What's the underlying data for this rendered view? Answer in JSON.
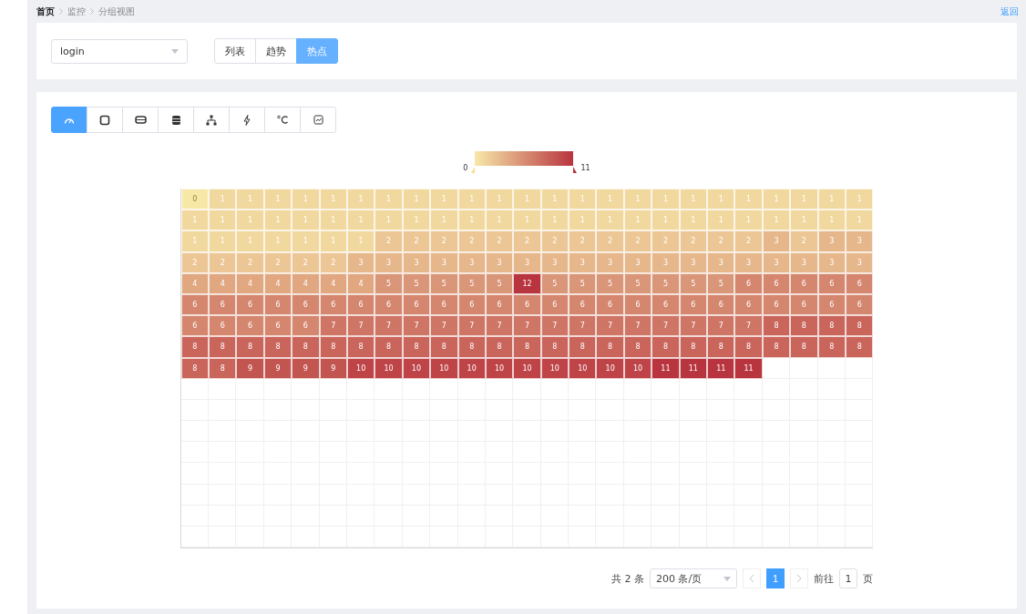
{
  "breadcrumb": [
    {
      "label": "首页",
      "current": true
    },
    {
      "label": "监控",
      "current": false
    },
    {
      "label": "分组视图",
      "current": false
    }
  ],
  "back_link": "返回",
  "group_select": {
    "value": "login"
  },
  "view_tabs": [
    {
      "label": "列表",
      "selected": false
    },
    {
      "label": "趋势",
      "selected": false
    },
    {
      "label": "热点",
      "selected": true
    }
  ],
  "metric_buttons": [
    {
      "kind": "gauge",
      "selected": true
    },
    {
      "kind": "chip",
      "selected": false
    },
    {
      "kind": "memory",
      "selected": false
    },
    {
      "kind": "disk",
      "selected": false
    },
    {
      "kind": "network",
      "selected": false
    },
    {
      "kind": "power",
      "selected": false
    },
    {
      "kind": "temperature",
      "selected": false
    },
    {
      "kind": "file",
      "selected": false
    }
  ],
  "legend": {
    "min": "0",
    "max": "11"
  },
  "heatmap": {
    "rows": [
      [
        "0",
        "1",
        "1",
        "1",
        "1",
        "1",
        "1",
        "1",
        "1",
        "1",
        "1",
        "1",
        "1",
        "1",
        "1",
        "1",
        "1",
        "1",
        "1",
        "1",
        "1",
        "1",
        "1",
        "1",
        "1"
      ],
      [
        "1",
        "1",
        "1",
        "1",
        "1",
        "1",
        "1",
        "1",
        "1",
        "1",
        "1",
        "1",
        "1",
        "1",
        "1",
        "1",
        "1",
        "1",
        "1",
        "1",
        "1",
        "1",
        "1",
        "1",
        "1"
      ],
      [
        "1",
        "1",
        "1",
        "1",
        "1",
        "1",
        "1",
        "2",
        "2",
        "2",
        "2",
        "2",
        "2",
        "2",
        "2",
        "2",
        "2",
        "2",
        "2",
        "2",
        "2",
        "3",
        "2",
        "3",
        "3"
      ],
      [
        "2",
        "2",
        "2",
        "2",
        "2",
        "2",
        "3",
        "3",
        "3",
        "3",
        "3",
        "3",
        "3",
        "3",
        "3",
        "3",
        "3",
        "3",
        "3",
        "3",
        "3",
        "3",
        "3",
        "3",
        "3"
      ],
      [
        "4",
        "4",
        "4",
        "4",
        "4",
        "4",
        "4",
        "5",
        "5",
        "5",
        "5",
        "5",
        "12",
        "5",
        "5",
        "5",
        "5",
        "5",
        "5",
        "5",
        "6",
        "6",
        "6",
        "6",
        "6"
      ],
      [
        "6",
        "6",
        "6",
        "6",
        "6",
        "6",
        "6",
        "6",
        "6",
        "6",
        "6",
        "6",
        "6",
        "6",
        "6",
        "6",
        "6",
        "6",
        "6",
        "6",
        "6",
        "6",
        "6",
        "6",
        "6"
      ],
      [
        "6",
        "6",
        "6",
        "6",
        "6",
        "7",
        "7",
        "7",
        "7",
        "7",
        "7",
        "7",
        "7",
        "7",
        "7",
        "7",
        "7",
        "7",
        "7",
        "7",
        "7",
        "8",
        "8",
        "8",
        "8"
      ],
      [
        "8",
        "8",
        "8",
        "8",
        "8",
        "8",
        "8",
        "8",
        "8",
        "8",
        "8",
        "8",
        "8",
        "8",
        "8",
        "8",
        "8",
        "8",
        "8",
        "8",
        "8",
        "8",
        "8",
        "8",
        "8"
      ],
      [
        "8",
        "8",
        "9",
        "9",
        "9",
        "9",
        "10",
        "10",
        "10",
        "10",
        "10",
        "10",
        "10",
        "10",
        "10",
        "10",
        "10",
        "11",
        "11",
        "11",
        "11"
      ]
    ]
  },
  "pagination": {
    "total": "共 2 条",
    "page_size": "200 条/页",
    "pages": [
      {
        "label": "1",
        "selected": true
      }
    ],
    "goto_label": "前往",
    "goto_value": "1",
    "goto_suffix": "页"
  }
}
